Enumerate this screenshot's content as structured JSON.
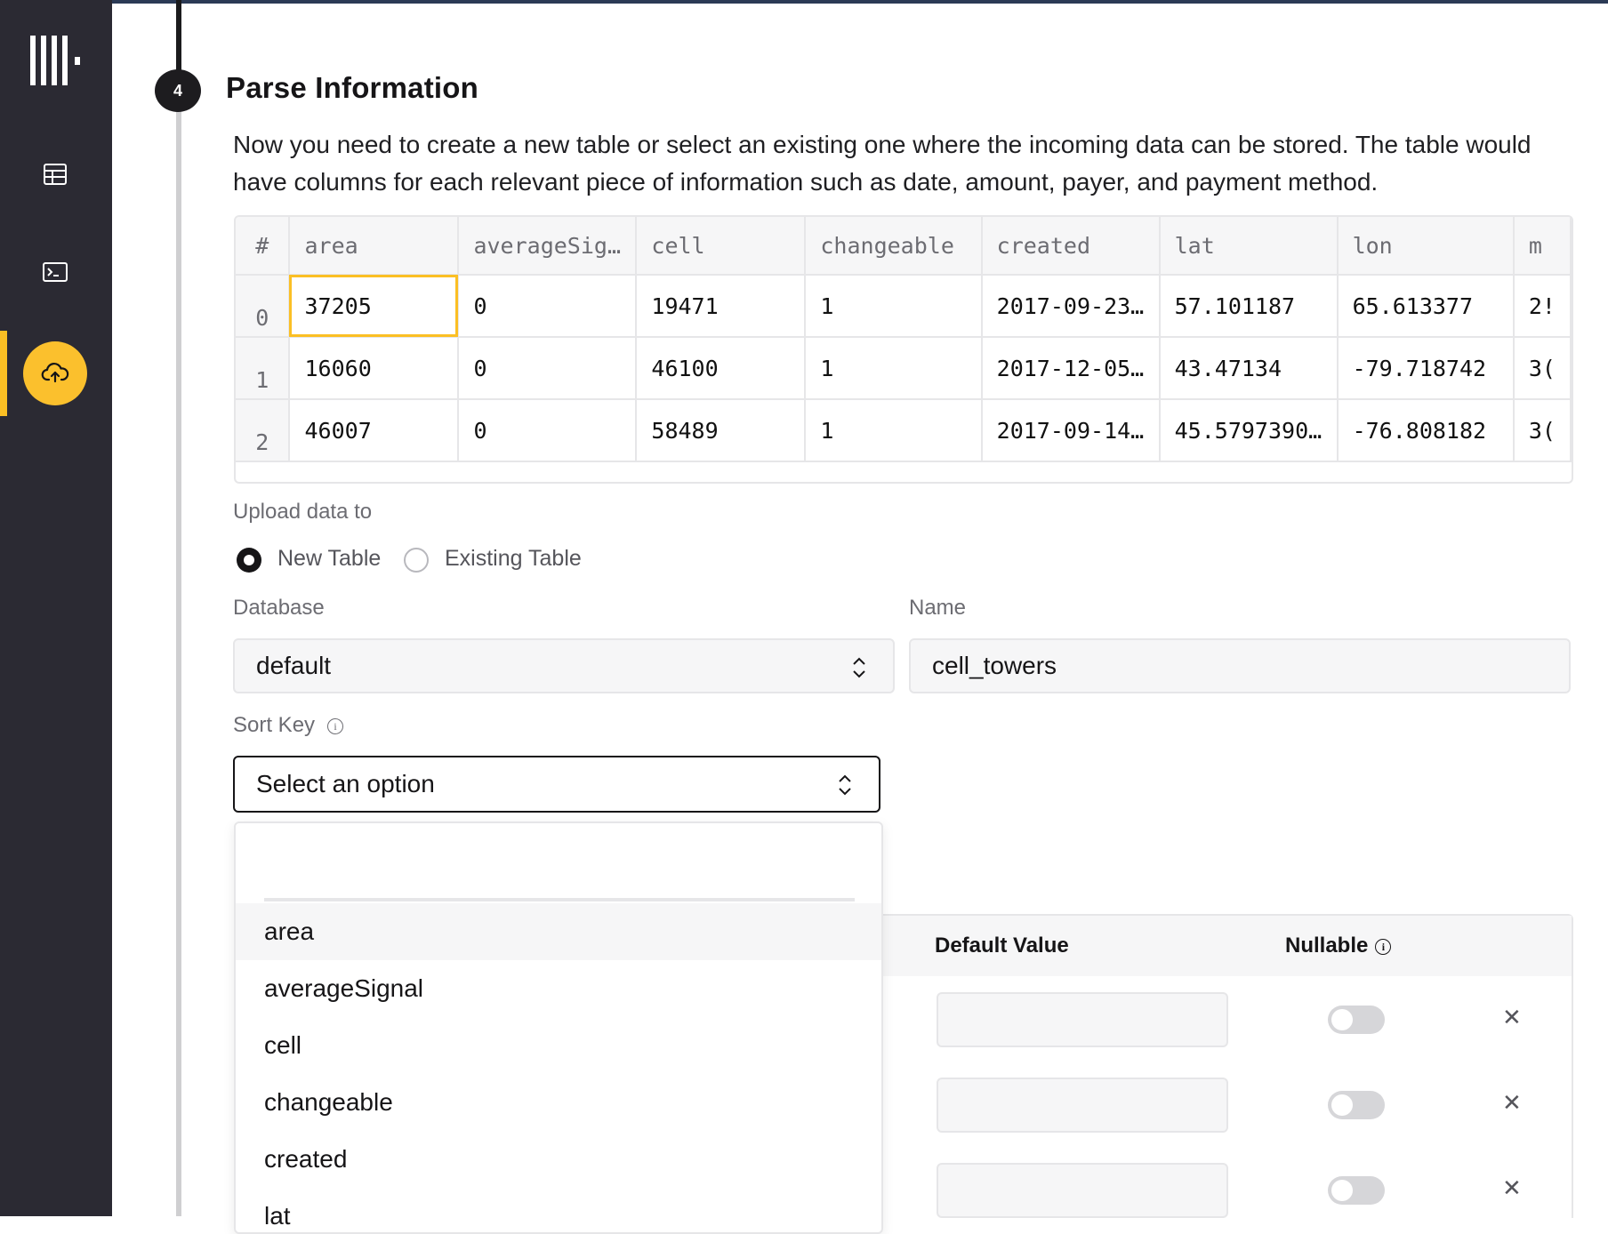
{
  "sidebar": {
    "icons": [
      "logo-icon",
      "table-icon",
      "terminal-icon",
      "cloud-upload-icon"
    ],
    "active": "cloud-upload-icon",
    "accent": "#fbbf24"
  },
  "step": {
    "number": "4",
    "title": "Parse Information",
    "description": "Now you need to create a new table or select an existing one where the incoming data can be stored. The table would have columns for each relevant piece of information such as date, amount, payer, and payment method."
  },
  "preview": {
    "headers": [
      "#",
      "area",
      "averageSig…",
      "cell",
      "changeable",
      "created",
      "lat",
      "lon",
      "m"
    ],
    "rows": [
      [
        "0",
        "37205",
        "0",
        "19471",
        "1",
        "2017-09-23…",
        "57.101187",
        "65.613377",
        "2!"
      ],
      [
        "1",
        "16060",
        "0",
        "46100",
        "1",
        "2017-12-05…",
        "43.47134",
        "-79.718742",
        "3("
      ],
      [
        "2",
        "46007",
        "0",
        "58489",
        "1",
        "2017-09-14…",
        "45.5797390…",
        "-76.808182",
        "3("
      ]
    ]
  },
  "upload": {
    "label": "Upload data to",
    "new_table": "New Table",
    "existing_table": "Existing Table",
    "selected": "new_table"
  },
  "database": {
    "label": "Database",
    "value": "default"
  },
  "name": {
    "label": "Name",
    "value": "cell_towers"
  },
  "sort_key": {
    "label": "Sort Key",
    "placeholder": "Select an option",
    "options": [
      "area",
      "averageSignal",
      "cell",
      "changeable",
      "created",
      "lat"
    ],
    "highlighted": "area"
  },
  "columns_panel": {
    "default_value_header": "Default Value",
    "nullable_header": "Nullable",
    "rows": [
      {
        "default_value": "",
        "nullable": false
      },
      {
        "default_value": "",
        "nullable": false
      },
      {
        "default_value": "",
        "nullable": false
      }
    ]
  }
}
